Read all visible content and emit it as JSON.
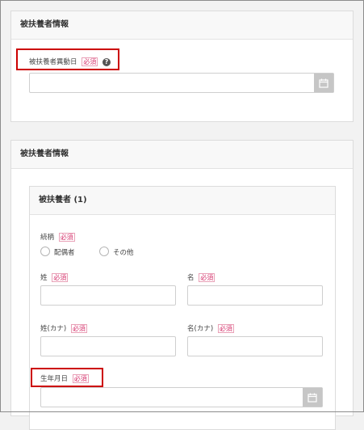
{
  "section1": {
    "title": "被扶養者情報",
    "change_date_label": "被扶養者異動日",
    "required_badge": "必須",
    "help_icon": "?",
    "change_date_value": ""
  },
  "section2": {
    "title": "被扶養者情報",
    "dependent": {
      "title": "被扶養者 (1)",
      "relationship_label": "続柄",
      "relationship_options": [
        "配偶者",
        "その他"
      ],
      "surname_label": "姓",
      "given_name_label": "名",
      "surname_kana_label": "姓(カナ)",
      "given_name_kana_label": "名(カナ)",
      "birthdate_label": "生年月日",
      "surname_value": "",
      "given_name_value": "",
      "surname_kana_value": "",
      "given_name_kana_value": "",
      "birthdate_value": ""
    }
  },
  "icons": {
    "calendar": "calendar-icon",
    "help": "help-icon"
  },
  "colors": {
    "required": "#d6336c",
    "highlight": "#cc0000",
    "calendar_button": "#c6c6c6"
  }
}
